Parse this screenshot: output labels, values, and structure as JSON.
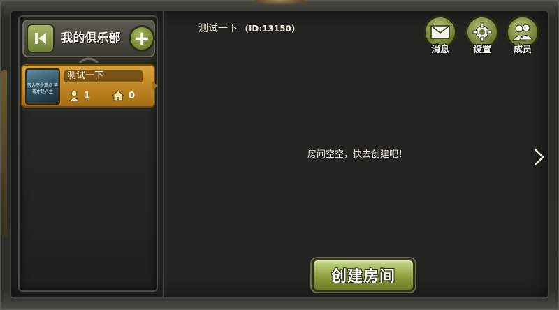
{
  "header": {
    "club_title": "我的俱乐部",
    "club_name": "测试一下",
    "club_id": "(ID:13150)"
  },
  "club_list": [
    {
      "name": "测试一下",
      "thumb_text": "努力不是重点 坚持才是人生",
      "members": "1",
      "rooms": "0"
    }
  ],
  "toolbar": {
    "messages_label": "消息",
    "settings_label": "设置",
    "members_label": "成员"
  },
  "main": {
    "empty_text": "房间空空，快去创建吧！",
    "create_room_label": "创建房间"
  },
  "icons": {
    "back": "back-icon",
    "add": "plus-icon",
    "messages": "envelope-icon",
    "settings": "gear-icon",
    "members": "people-icon",
    "member_count": "person-icon",
    "room_count": "house-icon",
    "next": "chevron-right-icon"
  },
  "colors": {
    "accent_green": "#8ea040",
    "selected_gold": "#d7a33a",
    "background": "#232320"
  }
}
